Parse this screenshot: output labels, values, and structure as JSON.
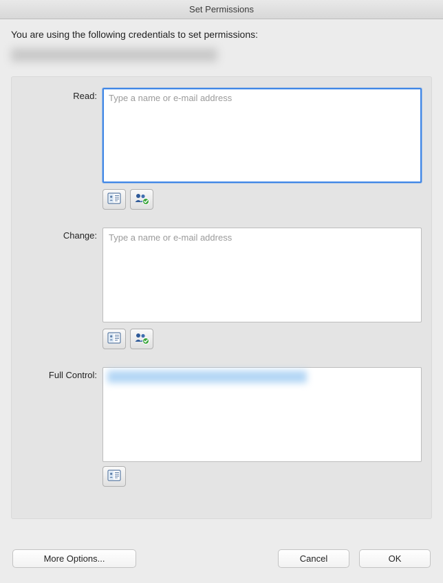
{
  "window": {
    "title": "Set Permissions"
  },
  "intro_text": "You are using the following credentials to set permissions:",
  "fields": {
    "read": {
      "label": "Read:",
      "placeholder": "Type a name or e-mail address",
      "value": ""
    },
    "change": {
      "label": "Change:",
      "placeholder": "Type a name or e-mail address",
      "value": ""
    },
    "full_control": {
      "label": "Full Control:"
    }
  },
  "buttons": {
    "more_options": "More Options...",
    "cancel": "Cancel",
    "ok": "OK"
  }
}
